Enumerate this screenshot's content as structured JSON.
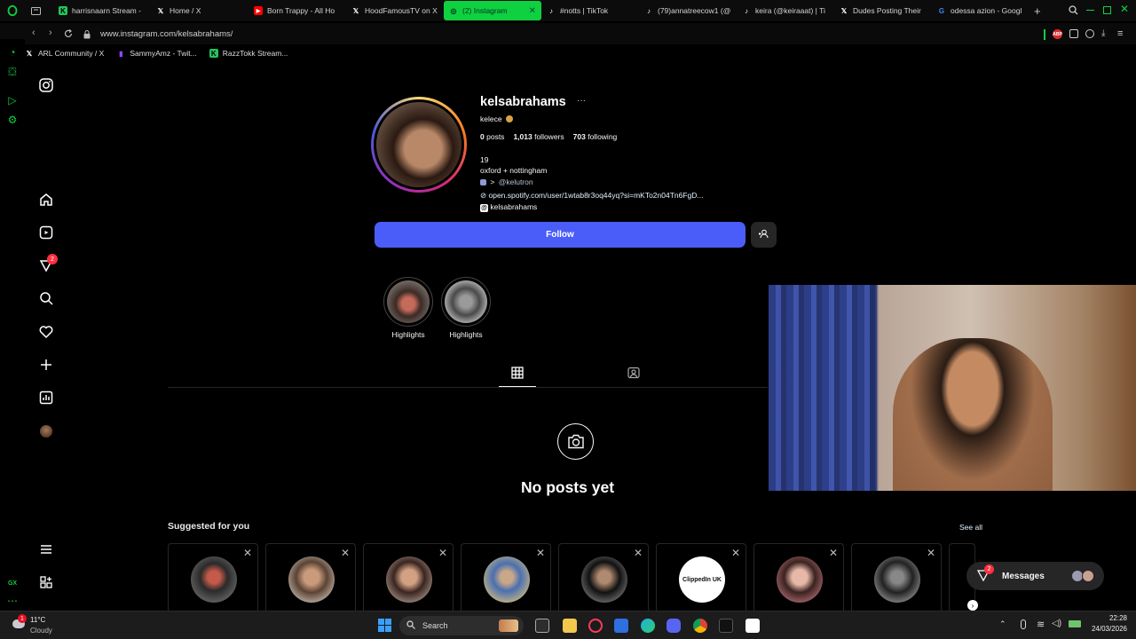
{
  "browser": {
    "tabs": [
      {
        "title": "harrisnaarn Stream -",
        "icon": "kick-icon",
        "color": "#22c55e"
      },
      {
        "title": "Home / X",
        "icon": "x-icon",
        "color": "#ffffff"
      },
      {
        "title": "Born Trappy - All Ho",
        "icon": "youtube-icon",
        "color": "#ff0000"
      },
      {
        "title": "HoodFamousTV on X",
        "icon": "x-icon",
        "color": "#ffffff"
      },
      {
        "title": "(2) Instagram",
        "icon": "instagram-icon",
        "color": "#e1306c",
        "active": true
      },
      {
        "title": "#notts | TikTok",
        "icon": "tiktok-icon",
        "color": "#ffffff"
      },
      {
        "title": "(79)annatreecow1 (@",
        "icon": "tiktok-icon",
        "color": "#ffffff"
      },
      {
        "title": "keira (@keiraaat) | Ti",
        "icon": "tiktok-icon",
        "color": "#ffffff"
      },
      {
        "title": "Dudes Posting Their",
        "icon": "x-icon",
        "color": "#ffffff"
      },
      {
        "title": "odessa azion - Googl",
        "icon": "google-icon",
        "color": "#4285f4"
      }
    ],
    "url": "www.instagram.com/kelsabrahams/",
    "bookmarks": [
      {
        "label": "ARL Community / X",
        "icon": "x-icon",
        "color": "#ffffff"
      },
      {
        "label": "SammyAmz - Twit...",
        "icon": "twitch-icon",
        "color": "#9146ff"
      },
      {
        "label": "RazzTokk Stream...",
        "icon": "kick-icon",
        "color": "#22c55e"
      }
    ]
  },
  "profile": {
    "username": "kelsabrahams",
    "name": "kelece",
    "posts_count": "0",
    "posts_label": "posts",
    "followers_count": "1,013",
    "followers_label": "followers",
    "following_count": "703",
    "following_label": "following",
    "bio_age": "19",
    "bio_location": "oxford + nottingham",
    "bio_arrow": ">",
    "bio_mention": "@kelutron",
    "bio_link": "open.spotify.com/user/1wtab8r3oq44yq?si=mKTo2n04Tn6FgD...",
    "threads_handle": "kelsabrahams",
    "follow_label": "Follow",
    "highlights": [
      {
        "label": "Highlights"
      },
      {
        "label": "Highlights"
      }
    ],
    "empty_title": "No posts yet"
  },
  "suggested": {
    "title": "Suggested for you",
    "see_all": "See all",
    "clippedin_text": "ClippedIn UK"
  },
  "messages": {
    "label": "Messages",
    "badge": "2"
  },
  "nav": {
    "notifications_badge": "2"
  },
  "taskbar": {
    "weather_temp": "11°C",
    "weather_desc": "Cloudy",
    "weather_badge": "1",
    "search_label": "Search",
    "time": "22:28",
    "date": "24/03/2026"
  }
}
